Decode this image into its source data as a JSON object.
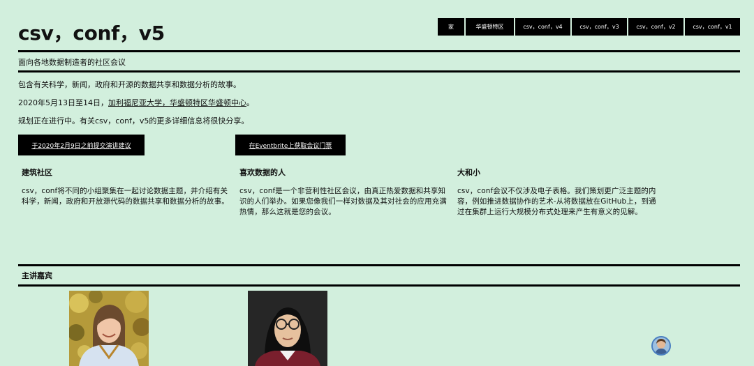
{
  "header": {
    "title": "csv，conf，v5"
  },
  "nav": {
    "items": [
      {
        "label": "家"
      },
      {
        "label": "华盛顿特区"
      },
      {
        "label": "csv，conf，v4"
      },
      {
        "label": "csv，conf，v3"
      },
      {
        "label": "csv，conf，v2"
      },
      {
        "label": "csv，conf，v1"
      }
    ]
  },
  "tagline": "面向各地数据制造者的社区会议",
  "intro": {
    "line1": "包含有关科学，新闻，政府和开源的数据共享和数据分析的故事。",
    "line2_prefix": "2020年5月13日至14日，",
    "line2_link": "加利福尼亚大学，华盛顿特区华盛顿中心",
    "line2_suffix": "。",
    "line3": "规划正在进行中。有关csv，conf，v5的更多详细信息将很快分享。"
  },
  "cta": {
    "proposal": "于2020年2月9日之前提交演讲建议",
    "tickets": "在Eventbrite上获取会议门票"
  },
  "features": [
    {
      "title": "建筑社区",
      "body": "csv，conf将不同的小组聚集在一起讨论数据主题，并介绍有关科学，新闻，政府和开放源代码的数据共享和数据分析的故事。"
    },
    {
      "title": "喜欢数据的人",
      "body": "csv，conf是一个非营利性社区会议，由真正热爱数据和共享知识的人们举办。如果您像我们一样对数据及其对社会的应用充满热情，那么这就是您的会议。"
    },
    {
      "title": "大和小",
      "body": "csv，conf会议不仅涉及电子表格。我们策划更广泛主题的内容，例如推进数据协作的艺术-从将数据放在GitHub上，到通过在集群上运行大规模分布式处理来产生有意义的见解。"
    }
  ],
  "keynotes": {
    "heading": "主讲嘉宾"
  },
  "colors": {
    "background": "#d2efdd",
    "button": "#000000",
    "text": "#111111"
  }
}
